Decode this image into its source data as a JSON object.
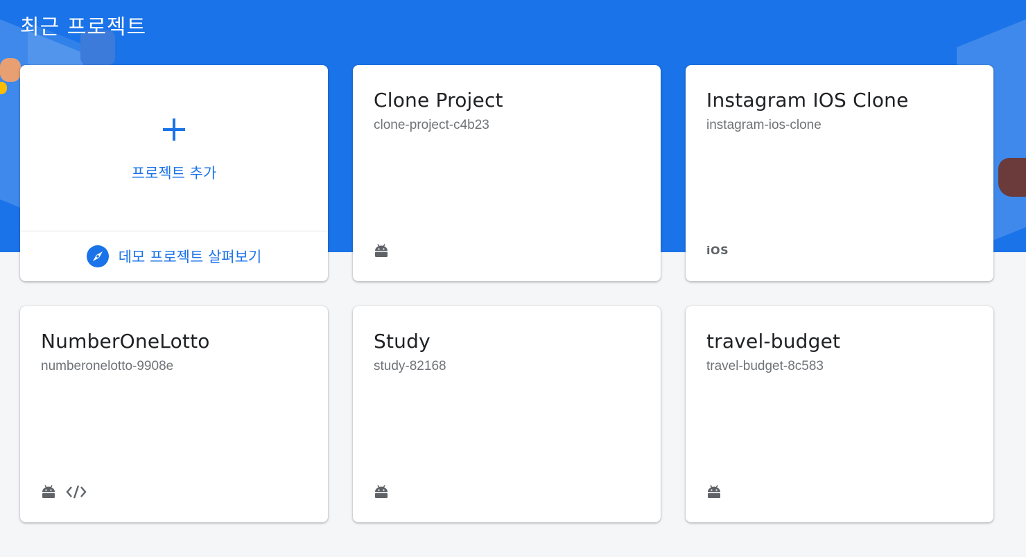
{
  "header": {
    "title": "최근 프로젝트"
  },
  "add_card": {
    "add_label": "프로젝트 추가",
    "demo_label": "데모 프로젝트 살펴보기"
  },
  "projects": [
    {
      "name": "Clone Project",
      "id": "clone-project-c4b23",
      "platforms": [
        "android"
      ]
    },
    {
      "name": "Instagram IOS Clone",
      "id": "instagram-ios-clone",
      "platforms": [
        "ios"
      ]
    },
    {
      "name": "NumberOneLotto",
      "id": "numberonelotto-9908e",
      "platforms": [
        "android",
        "web"
      ]
    },
    {
      "name": "Study",
      "id": "study-82168",
      "platforms": [
        "android"
      ]
    },
    {
      "name": "travel-budget",
      "id": "travel-budget-8c583",
      "platforms": [
        "android"
      ]
    }
  ],
  "platform_labels": {
    "ios": "iOS"
  },
  "colors": {
    "brand_blue": "#1a73e8",
    "background": "#f5f6f8",
    "icon_gray": "#5f6368"
  }
}
